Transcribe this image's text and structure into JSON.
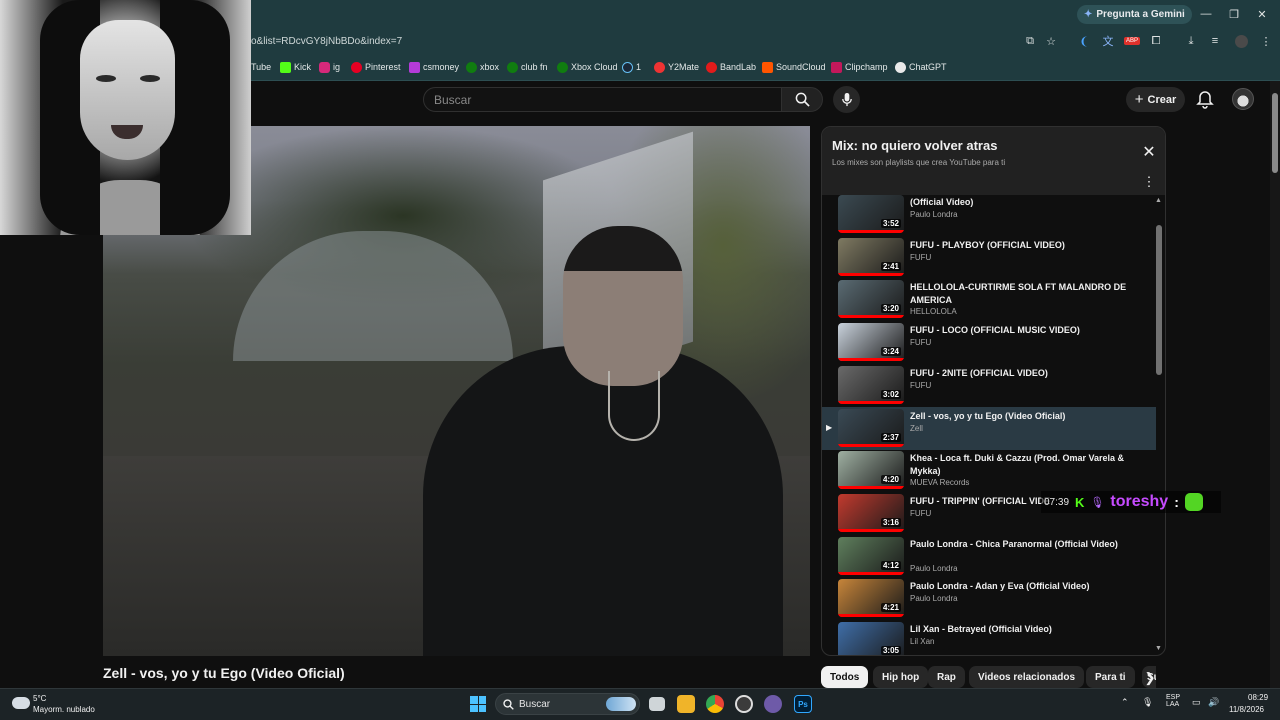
{
  "browser": {
    "gemini_label": "Pregunta a Gemini",
    "url": "o&list=RDcvGY8jNbBDo&index=7",
    "bookmarks": [
      "Tube",
      "Kick",
      "ig",
      "Pinterest",
      "csmoney",
      "xbox",
      "club fn",
      "Xbox Cloud",
      "1",
      "Y2Mate",
      "BandLab",
      "SoundCloud",
      "Clipchamp",
      "ChatGPT"
    ]
  },
  "youtube": {
    "search_placeholder": "Buscar",
    "create_label": "Crear",
    "video_title": "Zell - vos, yo y tu Ego (Video Oficial)"
  },
  "playlist": {
    "title": "Mix: no quiero volver atras",
    "subtitle": "Los mixes son playlists que crea YouTube para ti",
    "items": [
      {
        "title": "(Official Video)",
        "channel": "Paulo Londra",
        "duration": "3:52",
        "active": false
      },
      {
        "title": "FUFU - PLAYBOY (OFFICIAL VIDEO)",
        "channel": "FUFU",
        "duration": "2:41",
        "active": false
      },
      {
        "title": "HELLOLOLA-CURTIRME SOLA FT MALANDRO DE AMERICA",
        "channel": "HELLOLOLA",
        "duration": "3:20",
        "active": false
      },
      {
        "title": "FUFU - LOCO (OFFICIAL MUSIC VIDEO)",
        "channel": "FUFU",
        "duration": "3:24",
        "active": false
      },
      {
        "title": "FUFU - 2NITE (OFFICIAL VIDEO)",
        "channel": "FUFU",
        "duration": "3:02",
        "active": false
      },
      {
        "title": "Zell - vos, yo y tu Ego (Video Oficial)",
        "channel": "Zell",
        "duration": "2:37",
        "active": true
      },
      {
        "title": "Khea - Loca ft. Duki & Cazzu (Prod. Omar Varela & Mykka)",
        "channel": "MUEVA Records",
        "duration": "4:20",
        "active": false
      },
      {
        "title": "FUFU - TRIPPIN' (OFFICIAL VIDE",
        "channel": "FUFU",
        "duration": "3:16",
        "active": false
      },
      {
        "title": "Paulo Londra - Chica Paranormal (Official Video)",
        "channel": "Paulo Londra",
        "duration": "4:12",
        "active": false
      },
      {
        "title": "Paulo Londra - Adan y Eva (Official Video)",
        "channel": "Paulo Londra",
        "duration": "4:21",
        "active": false
      },
      {
        "title": "Lil Xan - Betrayed (Official Video)",
        "channel": "Lil Xan",
        "duration": "3:05",
        "active": false
      }
    ]
  },
  "chips": [
    "Todos",
    "Hip hop",
    "Rap",
    "Videos relacionados",
    "Para ti",
    "Su"
  ],
  "overlay": {
    "time": "07:39",
    "username": "toreshy",
    "colon": ":"
  },
  "taskbar": {
    "weather_temp": "5°C",
    "weather_desc": "Mayorm. nublado",
    "search_label": "Buscar",
    "lang1": "ESP",
    "lang2": "LAA",
    "time": "08:29",
    "date": "11/8/2026"
  },
  "colors": {
    "accent": "#ff0000",
    "kick_green": "#53fc18",
    "chat_name": "#c64bff"
  }
}
